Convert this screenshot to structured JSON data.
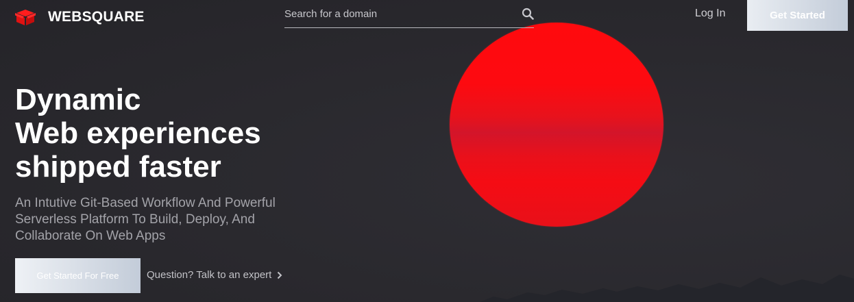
{
  "header": {
    "brand": "WEBSQUARE",
    "search_placeholder": "Search for a domain",
    "login_label": "Log In",
    "get_started_label": "Get Started"
  },
  "hero": {
    "headline_lines": [
      "Dynamic",
      "Web experiences",
      "shipped faster"
    ],
    "subtitle_lines": [
      "An Intutive Git-Based Workflow And Powerful",
      "Serverless Platform To Build, Deploy, And",
      "Collaborate On Web Apps"
    ],
    "cta_label": "Get Started For Free",
    "expert_link_label": "Question? Talk to an expert"
  },
  "icons": {
    "logo": "box-icon",
    "search": "search-icon",
    "chevron": "chevron-right-icon"
  },
  "colors": {
    "background": "#2b2a30",
    "accent_red": "#ff0a0e",
    "text_white": "#ffffff",
    "text_muted": "#a3a3a9",
    "button_gradient_start": "#e9edf2",
    "button_gradient_end": "#c3ccd9"
  }
}
